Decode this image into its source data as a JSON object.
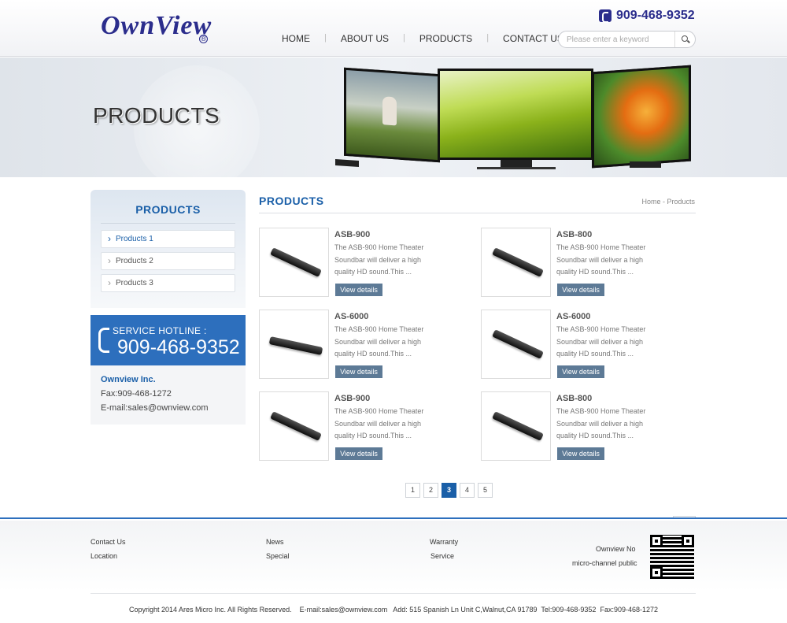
{
  "header": {
    "logo": "OwnView",
    "logo_mark": "®",
    "phone": "909-468-9352",
    "nav": [
      "HOME",
      "ABOUT US",
      "PRODUCTS",
      "CONTACT US"
    ],
    "search_placeholder": "Please enter a keyword"
  },
  "banner": {
    "title": "PRODUCTS"
  },
  "sidebar": {
    "title": "PRODUCTS",
    "items": [
      "Products 1",
      "Products 2",
      "Products 3"
    ],
    "hotline_label": "SERVICE HOTLINE :",
    "hotline_number": "909-468-9352",
    "company": "Ownview Inc.",
    "fax": "Fax:909-468-1272",
    "email": "E-mail:sales@ownview.com"
  },
  "main": {
    "title": "PRODUCTS",
    "breadcrumb": "Home - Products",
    "products": [
      {
        "name": "ASB-900",
        "desc": "The ASB-900 Home Theater Soundbar will deliver a high quality HD sound.This ...",
        "button": "View details"
      },
      {
        "name": "ASB-800",
        "desc": "The ASB-900 Home Theater Soundbar will deliver a high quality HD sound.This ...",
        "button": "View details"
      },
      {
        "name": "AS-6000",
        "desc": "The ASB-900 Home Theater Soundbar will deliver a high quality HD sound.This ...",
        "button": "View details"
      },
      {
        "name": "AS-6000",
        "desc": "The ASB-900 Home Theater Soundbar will deliver a high quality HD sound.This ...",
        "button": "View details"
      },
      {
        "name": "ASB-900",
        "desc": "The ASB-900 Home Theater Soundbar will deliver a high quality HD sound.This ...",
        "button": "View details"
      },
      {
        "name": "ASB-800",
        "desc": "The ASB-900 Home Theater Soundbar will deliver a high quality HD sound.This ...",
        "button": "View details"
      }
    ],
    "pagination": {
      "prev": "<<",
      "pages": [
        "1",
        "2",
        "3",
        "4",
        "5"
      ],
      "current": "3",
      "next": ">>"
    }
  },
  "footer": {
    "links": [
      "Contact Us",
      "Location",
      "News",
      "Special",
      "Warranty",
      "Service"
    ],
    "note1": "Ownview No",
    "note2": "micro-channel public",
    "copyright": "Copyright 2014 Ares Micro Inc. All Rights Reserved.    E-mail:sales@ownview.com   Add: 515 Spanish Ln Unit C,Walnut,CA 91789  Tel:909-468-9352  Fax:909-468-1272"
  },
  "colors": {
    "brand": "#2b2d8c",
    "accent": "#1a5fa8",
    "hotline_bg": "#2d6fbd",
    "button_bg": "#5d7a96"
  }
}
